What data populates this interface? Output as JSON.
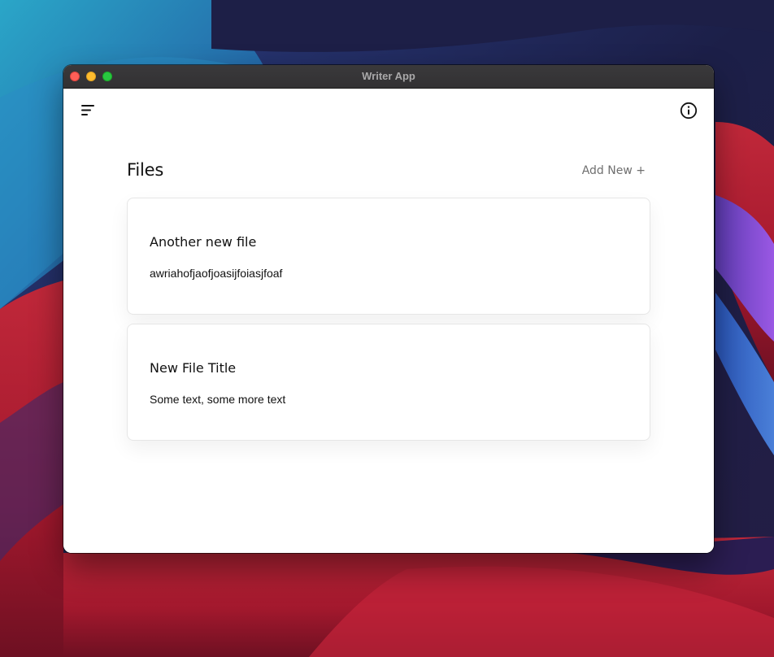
{
  "window": {
    "title": "Writer App"
  },
  "toolbar": {
    "menu_icon": "menu-lines-icon",
    "info_icon": "info-circle-icon"
  },
  "files": {
    "heading": "Files",
    "add_new_label": "Add New +",
    "items": [
      {
        "title": "Another new file",
        "preview": "awriahofjaofjoasijfoiasjfoaf"
      },
      {
        "title": "New File Title",
        "preview": "Some text, some more text"
      }
    ]
  },
  "colors": {
    "window_background": "#ffffff",
    "titlebar": "#353436",
    "traffic_close": "#fe5f57",
    "traffic_minimize": "#febc2e",
    "traffic_maximize": "#28c840",
    "muted_text": "#6f6f6f",
    "card_border": "#e6e6e6"
  }
}
